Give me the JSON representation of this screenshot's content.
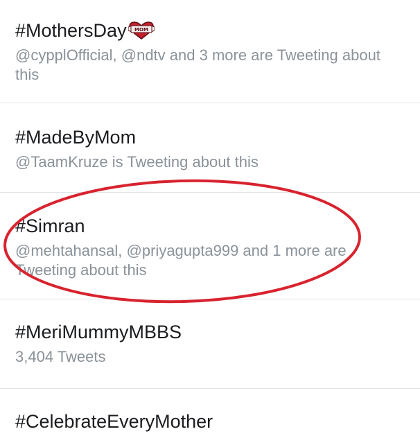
{
  "trends": [
    {
      "title": "#MothersDay",
      "context": "@cypplOfficial, @ndtv and 3 more are Tweeting about this",
      "icon": "heart-mom-tattoo-icon"
    },
    {
      "title": "#MadeByMom",
      "context": "@TaamKruze is Tweeting about this"
    },
    {
      "title": "#Simran",
      "context": "@mehtahansal, @priyagupta999 and 1 more are Tweeting about this"
    },
    {
      "title": "#MeriMummyMBBS",
      "context": "3,404 Tweets"
    },
    {
      "title": "#CelebrateEveryMother"
    }
  ],
  "annotation": {
    "type": "ellipse",
    "color": "#d8232f"
  },
  "heart_icon_text": "MOM"
}
